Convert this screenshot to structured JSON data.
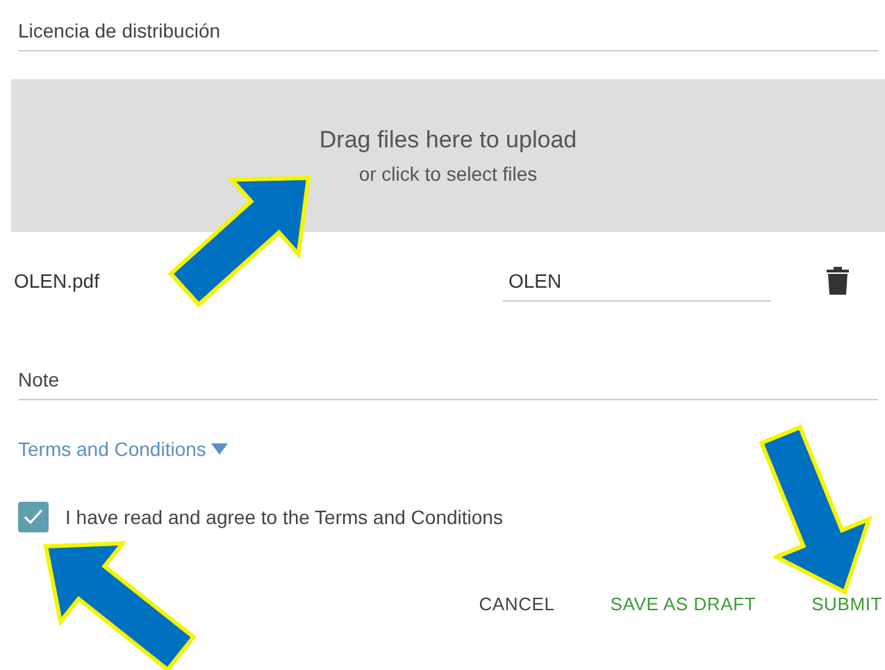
{
  "license_field": {
    "placeholder": "Licencia de distribución"
  },
  "dropzone": {
    "title": "Drag files here to upload",
    "subtitle": "or click to select files"
  },
  "files": [
    {
      "name": "OLEN.pdf",
      "label": "OLEN"
    }
  ],
  "note_field": {
    "placeholder": "Note"
  },
  "terms_link": {
    "label": "Terms and Conditions",
    "expanded": false
  },
  "agree": {
    "label": "I have read and agree to the Terms and Conditions",
    "checked": true
  },
  "buttons": [
    {
      "label": "CANCEL",
      "kind": "neutral"
    },
    {
      "label": "SAVE AS DRAFT",
      "kind": "primary"
    },
    {
      "label": "SUBMIT",
      "kind": "primary"
    }
  ]
}
